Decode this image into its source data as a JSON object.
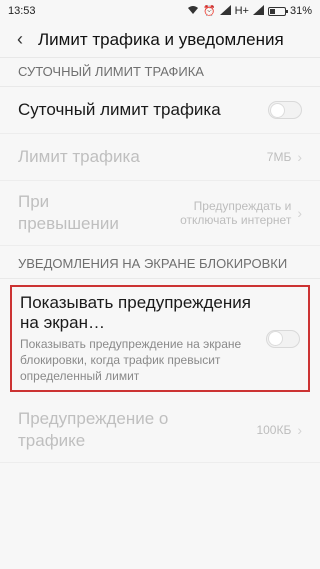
{
  "status": {
    "time": "13:53",
    "network": "H+",
    "battery": "31%"
  },
  "header": {
    "title": "Лимит трафика и уведомления"
  },
  "sections": {
    "daily": {
      "title": "СУТОЧНЫЙ ЛИМИТ ТРАФИКА",
      "rows": {
        "daily_limit": {
          "label": "Суточный лимит трафика"
        },
        "traffic_limit": {
          "label": "Лимит трафика",
          "value": "7МБ"
        },
        "on_exceed": {
          "label": "При превышении",
          "value": "Предупреждать и отключать интернет"
        }
      }
    },
    "lockscreen": {
      "title": "УВЕДОМЛЕНИЯ НА ЭКРАНЕ БЛОКИРОВКИ",
      "rows": {
        "show_warnings": {
          "label": "Показывать предупреждения на экран…",
          "desc": "Показывать предупреждение на экране блокировки, когда трафик превысит определенный лимит"
        },
        "traffic_warning": {
          "label": "Предупреждение о трафике",
          "value": "100КБ"
        }
      }
    }
  }
}
